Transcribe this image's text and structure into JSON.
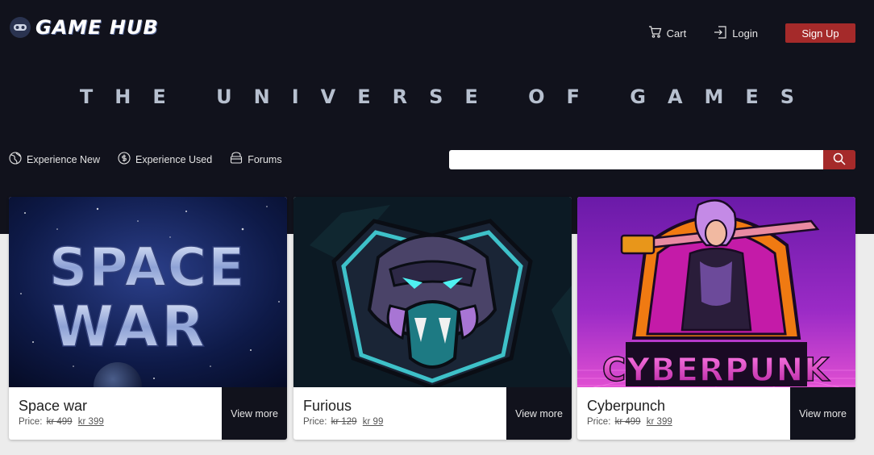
{
  "header": {
    "logo_text": "GAME HUB",
    "nav": [
      {
        "label": "Cart",
        "icon": "cart-icon"
      },
      {
        "label": "Login",
        "icon": "login-icon"
      }
    ],
    "signup_label": "Sign Up"
  },
  "hero": {
    "tagline": "THE UNIVERSE OF GAMES"
  },
  "subnav": [
    {
      "label": "Experience New",
      "icon": "globe-icon"
    },
    {
      "label": "Experience Used",
      "icon": "coin-icon"
    },
    {
      "label": "Forums",
      "icon": "forum-icon"
    }
  ],
  "search": {
    "value": "",
    "icon": "search-icon"
  },
  "cards": [
    {
      "title": "Space war",
      "price_label": "Price:",
      "old_price": "kr 499",
      "new_price": "kr 399",
      "button": "View more",
      "art_text": "SPACE WAR"
    },
    {
      "title": "Furious",
      "price_label": "Price:",
      "old_price": "kr 129",
      "new_price": "kr 99",
      "button": "View more",
      "art_text": ""
    },
    {
      "title": "Cyberpunch",
      "price_label": "Price:",
      "old_price": "kr 499",
      "new_price": "kr 399",
      "button": "View more",
      "art_text": "CYBERPUNK"
    }
  ],
  "colors": {
    "hero_bg": "#11121c",
    "accent": "#a52a2a",
    "card_button_bg": "#11121c"
  }
}
